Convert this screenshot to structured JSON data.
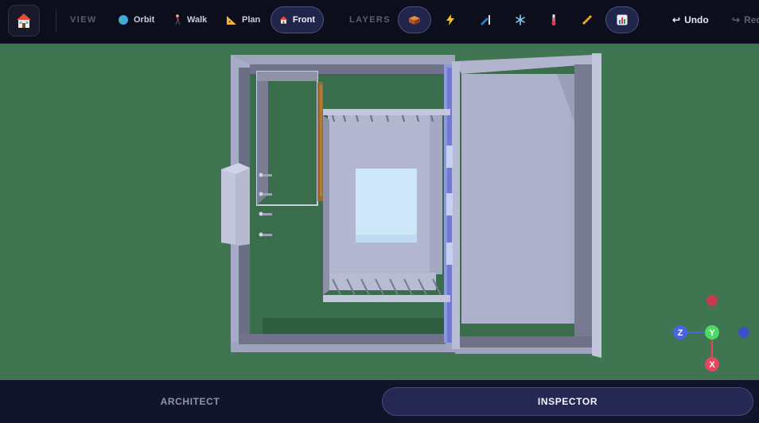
{
  "toolbar": {
    "view_label": "VIEW",
    "layers_label": "LAYERS",
    "view_modes": [
      {
        "label": "Orbit",
        "icon": "globe-icon",
        "active": false
      },
      {
        "label": "Walk",
        "icon": "walking-person-icon",
        "active": false
      },
      {
        "label": "Plan",
        "icon": "triangle-ruler-icon",
        "active": false
      },
      {
        "label": "Front",
        "icon": "house-icon",
        "active": true
      }
    ],
    "layers": [
      {
        "name": "structure",
        "icon": "bricks-icon",
        "active": true
      },
      {
        "name": "electrical",
        "icon": "lightning-icon",
        "active": false
      },
      {
        "name": "lighting",
        "icon": "lamp-icon",
        "active": false
      },
      {
        "name": "hvac",
        "icon": "snowflake-icon",
        "active": false
      },
      {
        "name": "thermal",
        "icon": "thermometer-icon",
        "active": false
      },
      {
        "name": "measure",
        "icon": "ruler-icon",
        "active": false
      },
      {
        "name": "analytics",
        "icon": "bar-chart-icon",
        "active": true
      }
    ],
    "undo_label": "Undo",
    "redo_label": "Redo"
  },
  "gizmo": {
    "axis_z": "Z",
    "axis_y": "Y",
    "axis_x": "X"
  },
  "tabs": {
    "architect": "ARCHITECT",
    "inspector": "INSPECTOR",
    "active": "inspector"
  },
  "colors": {
    "ground": "#3f7550",
    "toolbar_bg": "#0d0e1c",
    "accent": "#4b4f86",
    "axis_x": "#e5475f",
    "axis_y": "#4cd964",
    "axis_z": "#4a63e0"
  }
}
